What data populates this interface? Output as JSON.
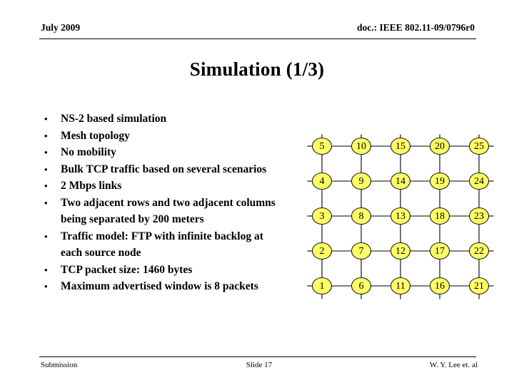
{
  "header": {
    "date": "July 2009",
    "doc": "doc.: IEEE 802.11-09/0796r0"
  },
  "title": "Simulation (1/3)",
  "bullets": [
    {
      "marker": "•",
      "text": "NS-2 based simulation"
    },
    {
      "marker": "•",
      "text": "Mesh topology"
    },
    {
      "marker": "•",
      "text": "No mobility"
    },
    {
      "marker": "•",
      "text": "Bulk TCP traffic based on several scenarios"
    },
    {
      "marker": "•",
      "text": "2 Mbps links"
    },
    {
      "marker": "•",
      "text": "Two adjacent rows and two adjacent columns being separated by 200 meters"
    },
    {
      "marker": "•",
      "text": "Traffic model: FTP with infinite backlog at each source node"
    },
    {
      "marker": "•",
      "text": "TCP packet size: 1460 bytes"
    },
    {
      "marker": "•",
      "text": "Maximum advertised window is 8 packets"
    }
  ],
  "mesh": {
    "rows": 5,
    "columns": 5,
    "node_fill": "#ffff66",
    "node_stroke": "#1a1a1a",
    "edge_color": "#000000",
    "labels_by_row_top_to_bottom": [
      [
        "5",
        "10",
        "15",
        "20",
        "25"
      ],
      [
        "4",
        "9",
        "14",
        "19",
        "24"
      ],
      [
        "3",
        "8",
        "13",
        "18",
        "23"
      ],
      [
        "2",
        "7",
        "12",
        "17",
        "22"
      ],
      [
        "1",
        "6",
        "11",
        "16",
        "21"
      ]
    ]
  },
  "footer": {
    "submission": "Submission",
    "slide": "Slide 17",
    "author": "W. Y. Lee et. al"
  }
}
